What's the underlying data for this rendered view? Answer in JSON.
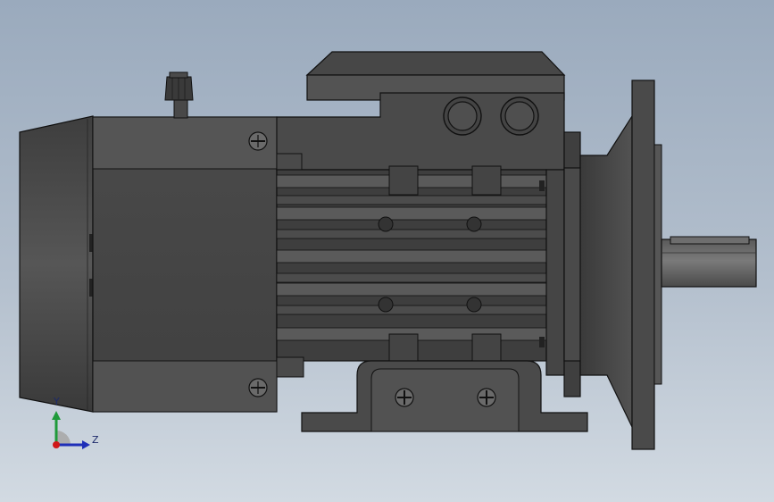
{
  "triad": {
    "y_label": "Y",
    "z_label": "Z",
    "colors": {
      "y_axis": "#1f9a3a",
      "z_axis": "#1f2fb8",
      "origin": "#d01818"
    }
  },
  "model_colors": {
    "body_dark": "#3c3c3c",
    "body_mid": "#4b4b4b",
    "body_light": "#5a5a5a",
    "edge": "#111111",
    "highlight": "#6e6e6e"
  }
}
